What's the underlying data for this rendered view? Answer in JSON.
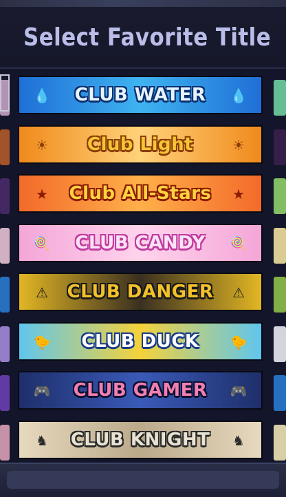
{
  "header": {
    "title": "Select Favorite Title"
  },
  "titles": [
    {
      "label": "CLUB WATER",
      "bg": "#1f6fd6",
      "bg2": "#3fb3f0",
      "fg": "#e6f4ff",
      "stroke": "#0b2f6e",
      "icon": "water-drop-icon",
      "glyph": "💧",
      "left_edge": "#c7a0c8",
      "right_edge": "#6fd0a0"
    },
    {
      "label": "Club Light",
      "bg": "#f08a1c",
      "bg2": "#ffd27a",
      "fg": "#f4c637",
      "stroke": "#8a3d00",
      "icon": "sun-icon",
      "glyph": "☀",
      "left_edge": "#b45a2a",
      "right_edge": "#3a1f4e"
    },
    {
      "label": "Club All-Stars",
      "bg": "#f36a2a",
      "bg2": "#ffb04a",
      "fg": "#ffd23f",
      "stroke": "#8a1d00",
      "icon": "star-badge-icon",
      "glyph": "★",
      "left_edge": "#4a2a6a",
      "right_edge": "#8fd06a"
    },
    {
      "label": "CLUB CANDY",
      "bg": "#f4a6d8",
      "bg2": "#ffd3ec",
      "fg": "#fbe3f6",
      "stroke": "#c03a9e",
      "icon": "lollipop-icon",
      "glyph": "🍭",
      "left_edge": "#e8c1d4",
      "right_edge": "#f2e0a0"
    },
    {
      "label": "CLUB DANGER",
      "bg": "#e2b624",
      "bg2": "#3a3020",
      "fg": "#f3c12a",
      "stroke": "#1a1a1a",
      "icon": "warning-sign-icon",
      "glyph": "⚠",
      "left_edge": "#2a7ad0",
      "right_edge": "#8fbf4a"
    },
    {
      "label": "CLUB DUCK",
      "bg": "#5fc6ee",
      "bg2": "#f4d23a",
      "fg": "#ffffff",
      "stroke": "#1a3c8a",
      "icon": "duck-icon",
      "glyph": "🐤",
      "left_edge": "#a48ad8",
      "right_edge": "#e9e9ef"
    },
    {
      "label": "CLUB GAMER",
      "bg": "#1e2f6a",
      "bg2": "#3a5ab8",
      "fg": "#f27fb0",
      "stroke": "#0b1030",
      "icon": "gamepad-icon",
      "glyph": "🎮",
      "left_edge": "#6a3fb0",
      "right_edge": "#2a7ad0"
    },
    {
      "label": "CLUB KNIGHT",
      "bg": "#e7d9bf",
      "bg2": "#bba98a",
      "fg": "#e8e2d2",
      "stroke": "#2a2a2a",
      "icon": "knight-helmet-icon",
      "glyph": "♞",
      "left_edge": "#d9a0b6",
      "right_edge": "#efe3b5"
    }
  ]
}
